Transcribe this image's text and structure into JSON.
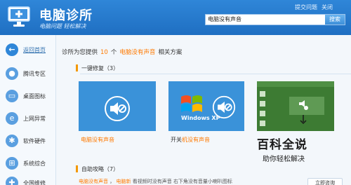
{
  "header": {
    "app_name": "电脑诊所",
    "slogan": "电脑问题  轻松解决",
    "feedback_link": "提交问题",
    "close_label": "关闭",
    "search": {
      "value": "电脑没有声音",
      "button": "搜索"
    }
  },
  "sidebar": {
    "items": [
      {
        "label": "返回首页",
        "icon": "back-arrow-icon"
      },
      {
        "label": "腾讯专区",
        "icon": "qq-penguin-icon"
      },
      {
        "label": "桌面图标",
        "icon": "desktop-icon"
      },
      {
        "label": "上网异常",
        "icon": "ie-browser-icon"
      },
      {
        "label": "软件硬件",
        "icon": "gear-icon"
      },
      {
        "label": "系统综合",
        "icon": "windows-icon"
      },
      {
        "label": "全国维修",
        "icon": "repair-icon"
      }
    ]
  },
  "main": {
    "title_prefix": "诊所为您提供",
    "count": "10",
    "title_mid": "个",
    "query": "电脑没有声音",
    "title_suffix": "相关方案",
    "section_repair": "一键修复（3）",
    "cards": [
      {
        "caption": "电脑没有声音",
        "caption_prefix": "",
        "caption_hl": "电脑没有声音"
      },
      {
        "caption": "开关机没有声音",
        "caption_prefix": "开关",
        "caption_hl": "机没有声音",
        "os_logo": "Windows XP"
      },
      {
        "caption": "",
        "caption_prefix": "",
        "caption_hl": ""
      }
    ],
    "section_help": "自助攻略（7）",
    "help_links": [
      "电脑没有声音",
      "电脑新",
      "看视频时没有声音",
      "右下角没有音量小喇叭图标"
    ],
    "consult_button": "立即咨询"
  },
  "watermark": {
    "big": "百科全说",
    "small": "助你轻松解决"
  },
  "colors": {
    "header": "#2f86d8",
    "accent": "#ff7a00",
    "card_blue": "#3a92d9"
  }
}
